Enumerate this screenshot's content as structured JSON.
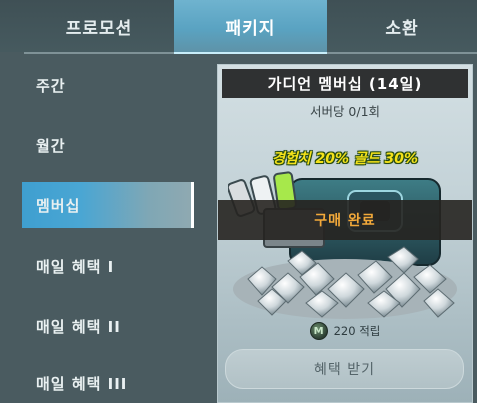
{
  "tabs": [
    {
      "label": "프로모션"
    },
    {
      "label": "패키지"
    },
    {
      "label": "소환"
    }
  ],
  "menu": {
    "items": [
      {
        "label": "주간"
      },
      {
        "label": "월간"
      },
      {
        "label": "멤버십"
      },
      {
        "label": "매일 혜택 I"
      },
      {
        "label": "매일 혜택 II"
      },
      {
        "label": "매일 혜택 III"
      }
    ]
  },
  "card": {
    "title": "가디언 멤버십 (14일)",
    "limit": "서버당 0/1회",
    "bonus": "경험치 20% 골드 30%",
    "status": "구매 완료",
    "points": "220 적립",
    "coin_letter": "M",
    "claim_label": "혜택 받기"
  },
  "colors": {
    "active_tab": "#5aa3c2",
    "active_menu": "#3f9fd0",
    "bonus_text": "#f4e21a",
    "status_text": "#f2a93a"
  }
}
